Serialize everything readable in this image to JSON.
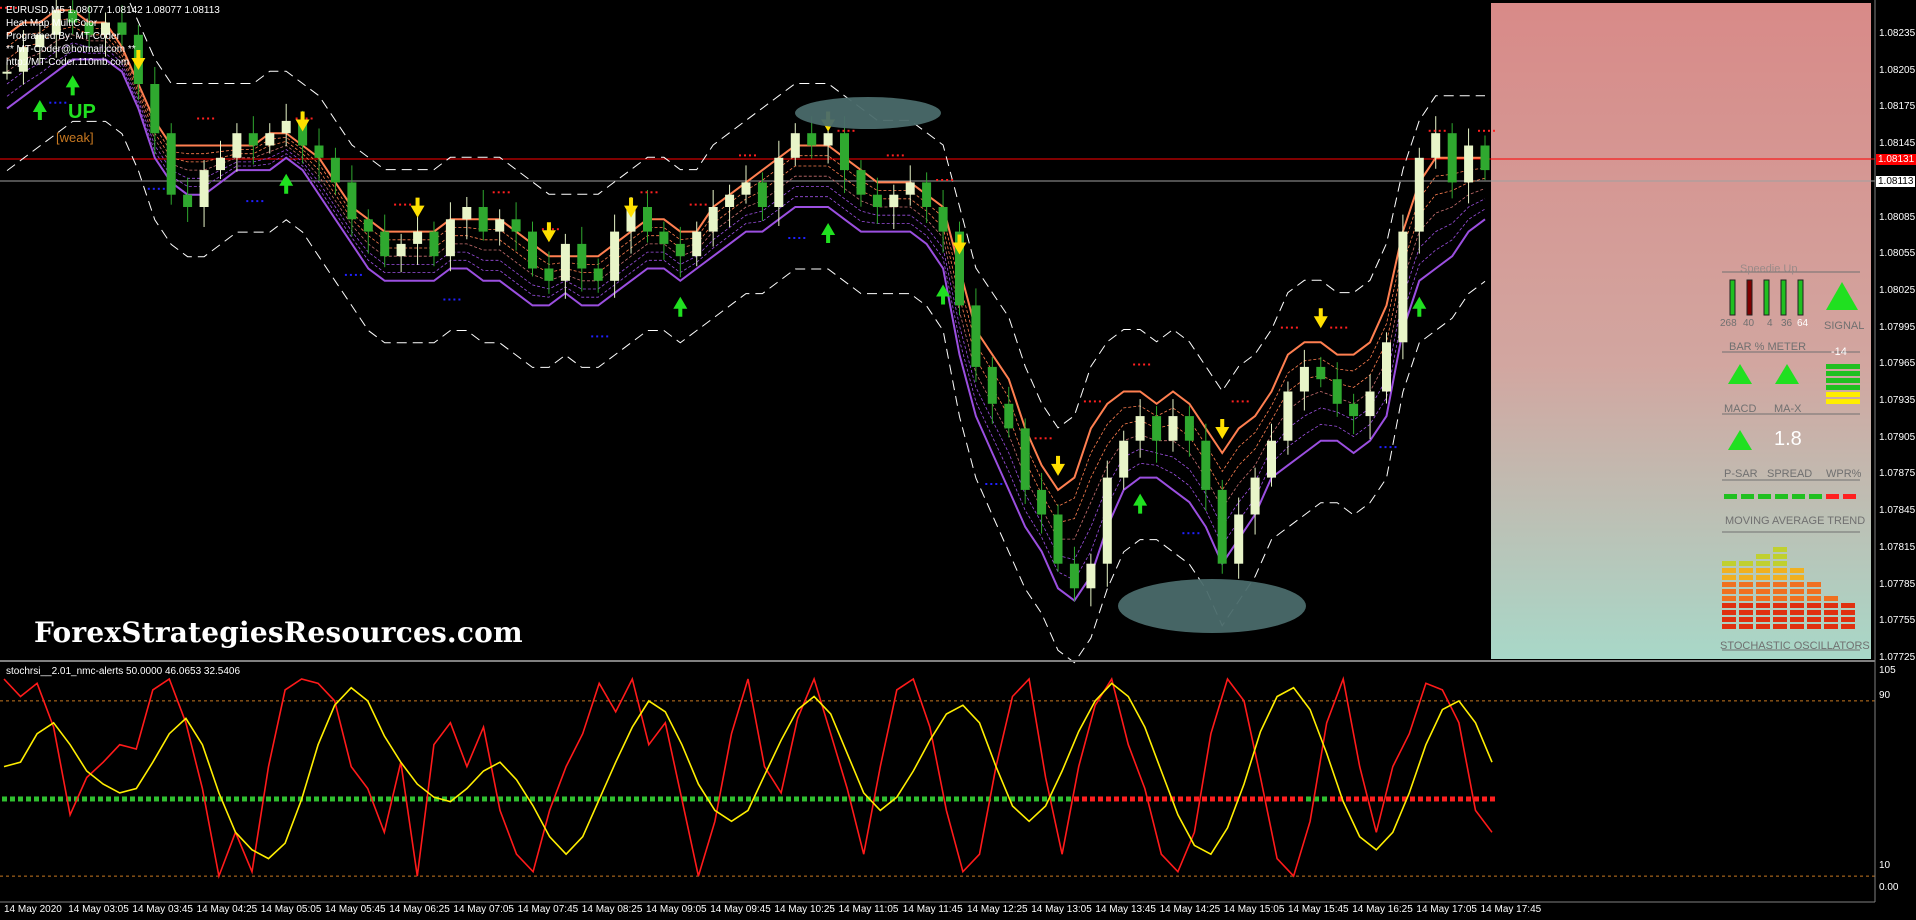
{
  "window": {
    "symbol_header": "EURUSD,M5  1.08077 1.08142 1.08077 1.08113",
    "indicator_lines": [
      "Heat Map MultiColor",
      "Programed By: MT-Coder",
      "** MT-Coder@hotmail.com **",
      "http://MT-Coder.110mb.com"
    ],
    "trend_label": "UP",
    "trend_strength": "[weak]",
    "watermark": "ForexStrategiesResources.com"
  },
  "colors": {
    "background": "#000000",
    "bull_candle": "#e8f5c8",
    "bear_candle": "#2fa82f",
    "upper_band": "#ff7f50",
    "lower_band": "#9b4fe0",
    "dash_band": "#ffffff",
    "sar_top": "#ff2020",
    "sar_bottom": "#2020ff",
    "arrow_down": "#ffe000",
    "arrow_up": "#20e020",
    "stoch_main": "#ff1a1a",
    "stoch_signal": "#ffee00",
    "level_line": "#c87820",
    "panel_top": "#d88a88",
    "panel_bottom": "#a8d8c8",
    "ellipse": "#4a6a6a"
  },
  "price_axis": {
    "labels": [
      "1.08235",
      "1.08205",
      "1.08175",
      "1.08145",
      "1.08115",
      "1.08085",
      "1.08055",
      "1.08025",
      "1.07995",
      "1.07965",
      "1.07935",
      "1.07905",
      "1.07875",
      "1.07845",
      "1.07815",
      "1.07785",
      "1.07755",
      "1.07725"
    ],
    "current_ask": "1.08131",
    "current_bid": "1.08113"
  },
  "time_axis": {
    "labels": [
      "14 May 2020",
      "14 May 03:05",
      "14 May 03:45",
      "14 May 04:25",
      "14 May 05:05",
      "14 May 05:45",
      "14 May 06:25",
      "14 May 07:05",
      "14 May 07:45",
      "14 May 08:25",
      "14 May 09:05",
      "14 May 09:45",
      "14 May 10:25",
      "14 May 11:05",
      "14 May 11:45",
      "14 May 12:25",
      "14 May 13:05",
      "14 May 13:45",
      "14 May 14:25",
      "14 May 15:05",
      "14 May 15:45",
      "14 May 16:25",
      "14 May 17:05",
      "14 May 17:45"
    ]
  },
  "dashboard": {
    "title": "Speedie Up",
    "bar_meter_values": [
      "268",
      "40",
      "4",
      "36",
      "64"
    ],
    "bar_meter_label": "BAR % METER",
    "signal_label": "SIGNAL",
    "wpr_value": "-14",
    "wpr_label": "WPR%",
    "macd_label": "MACD",
    "max_label": "MA-X",
    "psar_label": "P-SAR",
    "spread_label": "SPREAD",
    "spread_value": "1.8",
    "ma_trend_label": "MOVING AVERAGE TREND",
    "stoch_label": "STOCHASTIC OSCILLATORS"
  },
  "sub_window": {
    "header": "stochrsi__2.01_nmc-alerts 50.0000 46.0653 32.5406",
    "axis_labels": [
      "105",
      "90",
      "10",
      "0.00"
    ]
  },
  "chart_data": [
    {
      "type": "candlestick",
      "title": "EURUSD,M5",
      "ylim": [
        1.07715,
        1.08245
      ],
      "y": [
        1.0819,
        1.0821,
        1.0822,
        1.0824,
        1.0823,
        1.0822,
        1.0823,
        1.0822,
        1.0818,
        1.0814,
        1.0809,
        1.0808,
        1.0811,
        1.0812,
        1.0814,
        1.0813,
        1.0814,
        1.0815,
        1.0813,
        1.0812,
        1.081,
        1.0807,
        1.0806,
        1.0804,
        1.0805,
        1.0806,
        1.0804,
        1.0807,
        1.0808,
        1.0806,
        1.0807,
        1.0806,
        1.0803,
        1.0802,
        1.0805,
        1.0803,
        1.0802,
        1.0806,
        1.0808,
        1.0806,
        1.0805,
        1.0804,
        1.0806,
        1.0808,
        1.0809,
        1.081,
        1.0808,
        1.0812,
        1.0814,
        1.0813,
        1.0814,
        1.0811,
        1.0809,
        1.0808,
        1.0809,
        1.081,
        1.0808,
        1.0806,
        1.08,
        1.0795,
        1.0792,
        1.079,
        1.0785,
        1.0783,
        1.0779,
        1.0777,
        1.0779,
        1.0786,
        1.0789,
        1.0791,
        1.0789,
        1.0791,
        1.0789,
        1.0785,
        1.0779,
        1.0783,
        1.0786,
        1.0789,
        1.0793,
        1.0795,
        1.0794,
        1.0792,
        1.0791,
        1.0793,
        1.0797,
        1.0806,
        1.0812,
        1.0814,
        1.081,
        1.0813,
        1.0811
      ],
      "upper_band": [
        1.0822,
        1.0823,
        1.0823,
        1.0824,
        1.0824,
        1.0823,
        1.0823,
        1.0821,
        1.0818,
        1.0815,
        1.0813,
        1.0813,
        1.0813,
        1.0813,
        1.0813,
        1.0813,
        1.0814,
        1.0814,
        1.0813,
        1.0812,
        1.081,
        1.0808,
        1.0807,
        1.0806,
        1.0806,
        1.0806,
        1.0806,
        1.0807,
        1.0807,
        1.0807,
        1.0807,
        1.0806,
        1.0805,
        1.0804,
        1.0804,
        1.0804,
        1.0804,
        1.0805,
        1.0806,
        1.0807,
        1.0807,
        1.0806,
        1.0806,
        1.0808,
        1.0809,
        1.081,
        1.0811,
        1.0812,
        1.0813,
        1.0813,
        1.0813,
        1.0812,
        1.0811,
        1.081,
        1.081,
        1.081,
        1.0809,
        1.0808,
        1.0803,
        1.0798,
        1.0796,
        1.0794,
        1.079,
        1.0787,
        1.0785,
        1.0786,
        1.079,
        1.0792,
        1.0793,
        1.0793,
        1.0792,
        1.0793,
        1.0792,
        1.079,
        1.0788,
        1.079,
        1.0791,
        1.0793,
        1.0796,
        1.0797,
        1.0797,
        1.0796,
        1.0796,
        1.0797,
        1.08,
        1.0806,
        1.081,
        1.0812,
        1.0812,
        1.0812,
        1.0812
      ],
      "lower_band": [
        1.0816,
        1.0817,
        1.0818,
        1.0819,
        1.082,
        1.082,
        1.082,
        1.0819,
        1.0816,
        1.0812,
        1.081,
        1.0809,
        1.0809,
        1.081,
        1.0811,
        1.0811,
        1.0811,
        1.0812,
        1.0811,
        1.0809,
        1.0807,
        1.0805,
        1.0803,
        1.0802,
        1.0802,
        1.0802,
        1.0802,
        1.0803,
        1.0803,
        1.0802,
        1.0802,
        1.0801,
        1.08,
        1.08,
        1.0801,
        1.08,
        1.08,
        1.0801,
        1.0802,
        1.0803,
        1.0803,
        1.0802,
        1.0803,
        1.0804,
        1.0805,
        1.0806,
        1.0806,
        1.0807,
        1.0808,
        1.0808,
        1.0808,
        1.0807,
        1.0806,
        1.0806,
        1.0806,
        1.0806,
        1.0805,
        1.0803,
        1.0796,
        1.0791,
        1.0788,
        1.0785,
        1.0782,
        1.078,
        1.0777,
        1.0776,
        1.0778,
        1.0782,
        1.0785,
        1.0786,
        1.0786,
        1.0785,
        1.0784,
        1.0782,
        1.0779,
        1.0781,
        1.0783,
        1.0786,
        1.0787,
        1.0788,
        1.0789,
        1.0789,
        1.0788,
        1.0789,
        1.0791,
        1.0798,
        1.0802,
        1.0803,
        1.0804,
        1.0806,
        1.0807
      ]
    },
    {
      "type": "line",
      "title": "stochrsi__2.01_nmc-alerts",
      "ylim": [
        0,
        105
      ],
      "series": [
        {
          "values": [
            100,
            92,
            98,
            78,
            38,
            55,
            62,
            70,
            68,
            95,
            100,
            80,
            50,
            10,
            30,
            12,
            60,
            95,
            100,
            98,
            90,
            60,
            50,
            30,
            62,
            10,
            70,
            80,
            60,
            78,
            40,
            20,
            12,
            40,
            60,
            75,
            98,
            85,
            100,
            70,
            80,
            45,
            10,
            35,
            75,
            100,
            60,
            48,
            82,
            100,
            75,
            50,
            20,
            60,
            95,
            100,
            78,
            40,
            12,
            20,
            60,
            92,
            100,
            55,
            20,
            60,
            88,
            100,
            70,
            50,
            20,
            12,
            30,
            75,
            100,
            90,
            55,
            18,
            10,
            35,
            80,
            100,
            60,
            30,
            60,
            75,
            98,
            95,
            80,
            40,
            30
          ]
        },
        {
          "values": [
            60,
            62,
            75,
            80,
            70,
            58,
            52,
            48,
            50,
            62,
            75,
            82,
            70,
            48,
            30,
            22,
            18,
            25,
            45,
            70,
            88,
            96,
            90,
            74,
            62,
            52,
            46,
            44,
            50,
            58,
            62,
            54,
            42,
            28,
            20,
            28,
            45,
            62,
            78,
            90,
            85,
            70,
            52,
            40,
            35,
            40,
            56,
            72,
            86,
            92,
            84,
            66,
            48,
            40,
            46,
            58,
            72,
            84,
            88,
            80,
            60,
            42,
            35,
            42,
            58,
            76,
            90,
            98,
            92,
            78,
            58,
            38,
            24,
            20,
            32,
            52,
            76,
            92,
            96,
            86,
            66,
            44,
            28,
            22,
            30,
            48,
            70,
            86,
            90,
            80,
            62
          ]
        }
      ]
    }
  ]
}
